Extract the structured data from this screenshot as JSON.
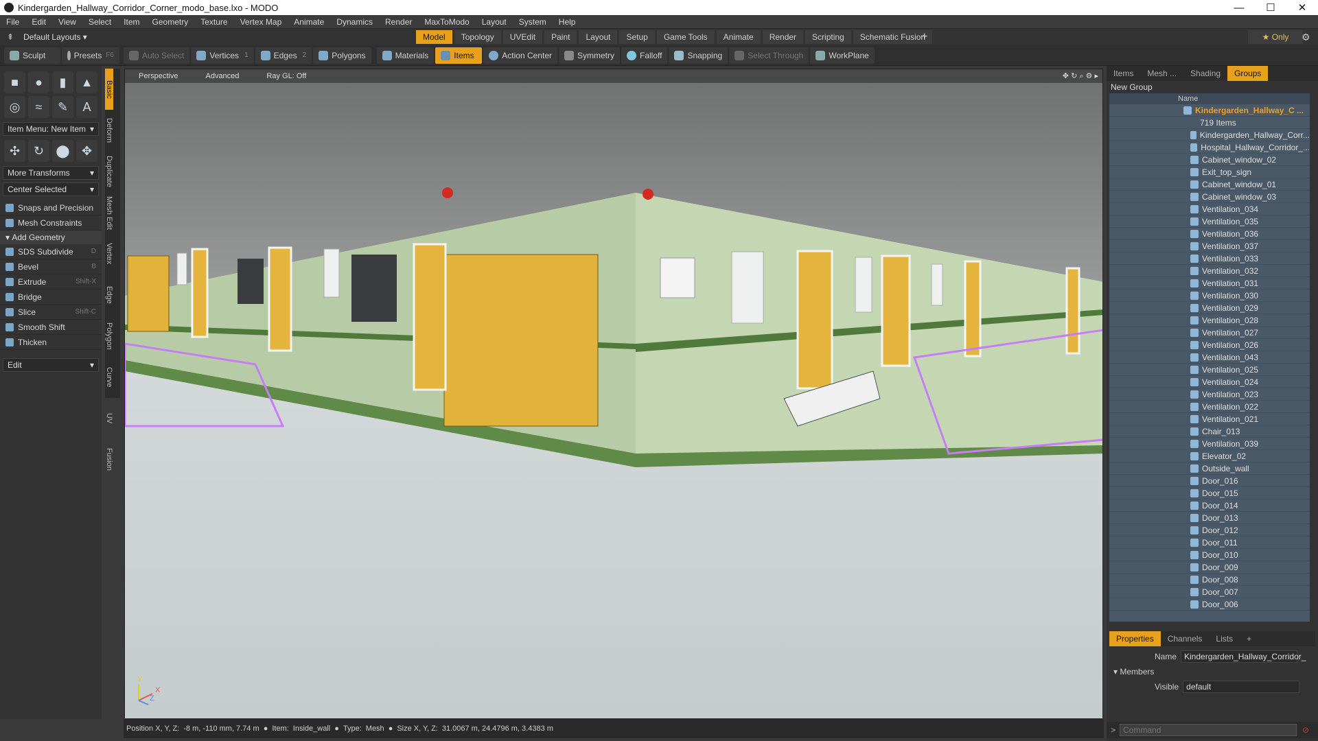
{
  "window": {
    "title": "Kindergarden_Hallway_Corridor_Corner_modo_base.lxo - MODO",
    "min": "—",
    "max": "☐",
    "close": "✕"
  },
  "menu": [
    "File",
    "Edit",
    "View",
    "Select",
    "Item",
    "Geometry",
    "Texture",
    "Vertex Map",
    "Animate",
    "Dynamics",
    "Render",
    "MaxToModo",
    "Layout",
    "System",
    "Help"
  ],
  "layouts": {
    "default": "Default Layouts ▾",
    "tabs": [
      "Model",
      "Topology",
      "UVEdit",
      "Paint",
      "Layout",
      "Setup",
      "Game Tools",
      "Animate",
      "Render",
      "Scripting",
      "Schematic Fusion"
    ],
    "active": "Model",
    "only": "★ Only"
  },
  "toolbar": {
    "sculpt": "Sculpt",
    "presets": "Presets",
    "presets_key": "F6",
    "auto_select": "Auto Select",
    "vertices": "Vertices",
    "vert_n": "1",
    "edges": "Edges",
    "edge_n": "2",
    "polygons": "Polygons",
    "materials": "Materials",
    "items": "Items",
    "action_center": "Action Center",
    "symmetry": "Symmetry",
    "falloff": "Falloff",
    "snapping": "Snapping",
    "select_through": "Select Through",
    "workplane": "WorkPlane"
  },
  "left": {
    "item_menu": "Item Menu: New Item",
    "more_transforms": "More Transforms",
    "center_selected": "Center Selected",
    "snaps": "Snaps and Precision",
    "mesh_constraints": "Mesh Constraints",
    "add_geometry": "Add Geometry",
    "tools": [
      {
        "label": "SDS Subdivide",
        "key": "D"
      },
      {
        "label": "Bevel",
        "key": "B"
      },
      {
        "label": "Extrude",
        "key": "Shift-X"
      },
      {
        "label": "Bridge",
        "key": ""
      },
      {
        "label": "Slice",
        "key": "Shift-C"
      },
      {
        "label": "Smooth Shift",
        "key": ""
      },
      {
        "label": "Thicken",
        "key": ""
      }
    ],
    "edit": "Edit"
  },
  "vtabs": [
    "Basic",
    "Deform",
    "Duplicate",
    "Mesh Edit",
    "Vertex",
    "Edge",
    "Polygon",
    "Curve",
    "UV",
    "Fusion"
  ],
  "viewport": {
    "perspective": "Perspective",
    "advanced": "Advanced",
    "raygl": "Ray GL: Off",
    "axis_y": "Y",
    "axis_z": "Z",
    "axis_x": "X"
  },
  "status": {
    "position": "Position X, Y, Z:",
    "pos_val": "-8 m, -110 mm, 7.74 m",
    "item": "Item:",
    "item_val": "Inside_wall",
    "type": "Type:",
    "type_val": "Mesh",
    "size": "Size X, Y, Z:",
    "size_val": "31.0067 m, 24.4796 m, 3.4383 m"
  },
  "right": {
    "tabs": [
      "Items",
      "Mesh ...",
      "Shading",
      "Groups"
    ],
    "active": "Groups",
    "new_group": "New Group",
    "name_col": "Name",
    "root": "Kindergarden_Hallway_C ...",
    "count": "719 Items",
    "items": [
      "Kindergarden_Hallway_Corr...",
      "Hospital_Hallway_Corridor_...",
      "Cabinet_window_02",
      "Exit_top_sign",
      "Cabinet_window_01",
      "Cabinet_window_03",
      "Ventilation_034",
      "Ventilation_035",
      "Ventilation_036",
      "Ventilation_037",
      "Ventilation_033",
      "Ventilation_032",
      "Ventilation_031",
      "Ventilation_030",
      "Ventilation_029",
      "Ventilation_028",
      "Ventilation_027",
      "Ventilation_026",
      "Ventilation_043",
      "Ventilation_025",
      "Ventilation_024",
      "Ventilation_023",
      "Ventilation_022",
      "Ventilation_021",
      "Chair_013",
      "Ventilation_039",
      "Elevator_02",
      "Outside_wall",
      "Door_016",
      "Door_015",
      "Door_014",
      "Door_013",
      "Door_012",
      "Door_011",
      "Door_010",
      "Door_009",
      "Door_008",
      "Door_007",
      "Door_006"
    ],
    "props_tabs": [
      "Properties",
      "Channels",
      "Lists",
      "+"
    ],
    "name_label": "Name",
    "name_val": "Kindergarden_Hallway_Corridor_",
    "members": "Members",
    "visible_label": "Visible",
    "visible_val": "default",
    "cmd_placeholder": "Command"
  }
}
